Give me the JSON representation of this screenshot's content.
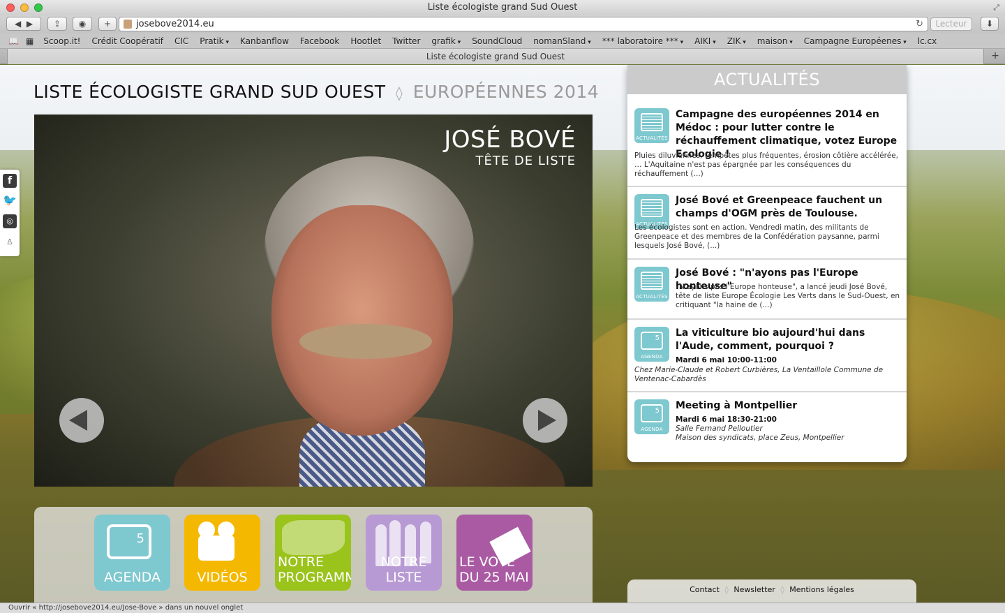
{
  "browser": {
    "window_title": "Liste écologiste grand Sud Ouest",
    "address": "josebove2014.eu",
    "reader_label": "Lecteur",
    "tab_title": "Liste écologiste grand Sud Ouest",
    "bookmarks": [
      "Scoop.it!",
      "Crédit Coopératif",
      "CIC",
      "Pratik",
      "Kanbanflow",
      "Facebook",
      "Hootlet",
      "Twitter",
      "grafik",
      "SoundCloud",
      "nomanSland",
      "*** laboratoire ***",
      "AIKI",
      "ZIK",
      "maison",
      "Campagne Européenes",
      "lc.cx"
    ],
    "status_text": "Ouvrir « http://josebove2014.eu/Jose-Bove » dans un nouvel onglet"
  },
  "header": {
    "title": "LISTE ÉCOLOGISTE GRAND SUD OUEST",
    "separator": "◊",
    "subtitle": "EUROPÉENNES 2014"
  },
  "hero": {
    "name": "JOSÉ BOVÉ",
    "role": "TÊTE DE LISTE"
  },
  "tiles": {
    "agenda": "AGENDA",
    "videos": "VIDÉOS",
    "programme_1": "NOTRE",
    "programme_2": "PROGRAMME",
    "liste": "NOTRE LISTE",
    "vote_1": "LE VOTE",
    "vote_2": "DU 25 MAI"
  },
  "news": {
    "heading": "ACTUALITÉS",
    "icon_caption_news": "ACTUALITÉS",
    "icon_caption_agenda": "AGENDA",
    "items": [
      {
        "title": "Campagne des européennes 2014 en Médoc : pour lutter contre le réchauffement climatique, votez Europe Ecologie !",
        "excerpt": "Pluies diluviennes, tempêtes plus fréquentes, érosion côtière accélérée, … L'Aquitaine n'est pas épargnée par les conséquences du réchauffement (...)"
      },
      {
        "title": "José Bové et Greenpeace fauchent un champs d'OGM près de Toulouse.",
        "excerpt": "Les écologistes sont en action. Vendredi matin, des militants de Greenpeace et des membres de la Confédération paysanne, parmi lesquels José Bové, (...)"
      },
      {
        "title": "José Bové : \"n'ayons pas l'Europe honteuse\"",
        "excerpt": "\"N'ayons pas l'Europe honteuse\", a lancé jeudi José Bové, tête de liste Europe Écologie Les Verts dans le Sud-Ouest, en critiquant \"la haine de (...)"
      },
      {
        "title": "La viticulture bio aujourd'hui dans l'Aude, comment, pourquoi ?",
        "date": "Mardi 6 mai 10:00-11:00",
        "place": "Chez Marie-Claude et Robert Curbières, La Ventaillole Commune de Ventenac-Cabardès"
      },
      {
        "title": "Meeting à Montpellier",
        "date": "Mardi 6 mai 18:30-21:00",
        "place_1": "Salle Fernand Pelloutier",
        "place_2": "Maison des syndicats, place Zeus, Montpellier"
      }
    ]
  },
  "footer": {
    "contact": "Contact",
    "newsletter": "Newsletter",
    "mentions": "Mentions légales",
    "separator": "◊"
  },
  "colors": {
    "agenda": "#7ec8cf",
    "videos": "#f5b800",
    "programme": "#9ac31c",
    "liste": "#b79ad3",
    "vote": "#a95aa3"
  }
}
